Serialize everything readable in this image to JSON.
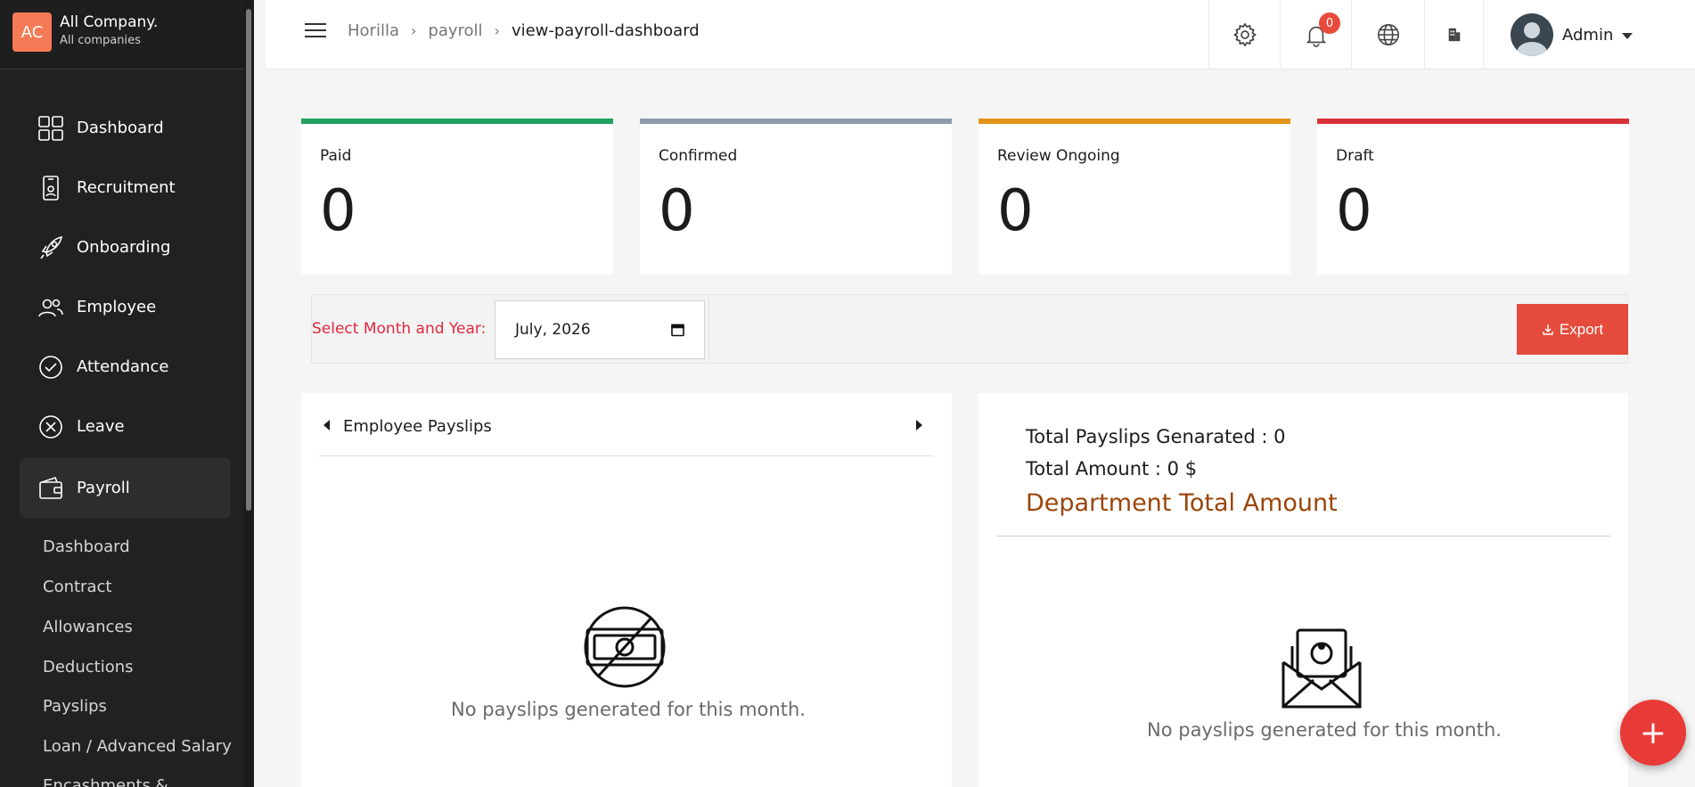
{
  "company": {
    "initials": "AC",
    "name": "All Company.",
    "subtitle": "All companies"
  },
  "sidebar": {
    "items": [
      {
        "label": "Dashboard",
        "icon": "dashboard-icon"
      },
      {
        "label": "Recruitment",
        "icon": "recruitment-icon"
      },
      {
        "label": "Onboarding",
        "icon": "rocket-icon"
      },
      {
        "label": "Employee",
        "icon": "employees-icon"
      },
      {
        "label": "Attendance",
        "icon": "check-circle-icon"
      },
      {
        "label": "Leave",
        "icon": "close-circle-icon"
      },
      {
        "label": "Payroll",
        "icon": "wallet-icon",
        "active": true
      }
    ],
    "payroll_sub": [
      "Dashboard",
      "Contract",
      "Allowances",
      "Deductions",
      "Payslips",
      "Loan / Advanced Salary",
      "Encashments &"
    ]
  },
  "header": {
    "breadcrumbs": [
      "Horilla",
      "payroll",
      "view-payroll-dashboard"
    ],
    "notification_count": "0",
    "user_name": "Admin"
  },
  "stats": [
    {
      "label": "Paid",
      "value": "0",
      "color": "#21a05f"
    },
    {
      "label": "Confirmed",
      "value": "0",
      "color": "#8e9aaf"
    },
    {
      "label": "Review Ongoing",
      "value": "0",
      "color": "#e59219"
    },
    {
      "label": "Draft",
      "value": "0",
      "color": "#d93035"
    }
  ],
  "filter": {
    "label": "Select Month and Year:",
    "value": "July, 2026",
    "export_label": "Export"
  },
  "payslips_panel": {
    "title": "Employee Payslips",
    "empty_text": "No payslips generated for this month."
  },
  "summary_panel": {
    "total_generated": "Total Payslips Genarated : 0",
    "total_amount": "Total Amount : 0 $",
    "dept_title": "Department Total Amount",
    "empty_text": "No payslips generated for this month."
  },
  "fab_label": "+"
}
